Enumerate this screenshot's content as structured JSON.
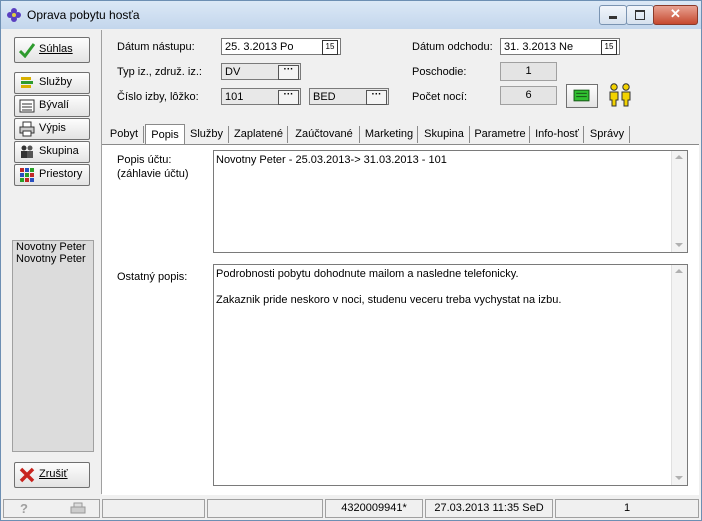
{
  "window": {
    "title": "Oprava pobytu hosťa"
  },
  "sidebar": {
    "buttons": [
      {
        "label": "Súhlas"
      },
      {
        "label": "Služby"
      },
      {
        "label": "Bývalí"
      },
      {
        "label": "Výpis"
      },
      {
        "label": "Skupina"
      },
      {
        "label": "Priestory"
      }
    ],
    "guests": [
      "Novotny Peter",
      "Novotny Peter"
    ],
    "cancel_label": "Zrušiť"
  },
  "form": {
    "arrival_label": "Dátum nástupu:",
    "arrival_value": "25. 3.2013  Po",
    "departure_label": "Dátum odchodu:",
    "departure_value": "31. 3.2013  Ne",
    "type_label": "Typ iz., združ. iz.:",
    "type_value": "DV",
    "floor_label": "Poschodie:",
    "floor_value": "1",
    "room_label": "Číslo izby, lôžko:",
    "room_value": "101",
    "bed_value": "BED",
    "nights_label": "Počet nocí:",
    "nights_value": "6",
    "calendar_icon_text": "15"
  },
  "tabs": [
    {
      "label": "Pobyt"
    },
    {
      "label": "Popis"
    },
    {
      "label": "Služby"
    },
    {
      "label": "Zaplatené"
    },
    {
      "label": "Zaúčtované"
    },
    {
      "label": "Marketing"
    },
    {
      "label": "Skupina"
    },
    {
      "label": "Parametre"
    },
    {
      "label": "Info-hosť"
    },
    {
      "label": "Správy"
    }
  ],
  "popis": {
    "account_label_1": "Popis účtu:",
    "account_label_2": "(záhlavie účtu)",
    "account_text": "Novotny Peter - 25.03.2013-> 31.03.2013 - 101",
    "other_label": "Ostatný popis:",
    "other_line_1": "Podrobnosti pobytu dohodnute mailom a nasledne telefonicky.",
    "other_line_2": "Zakaznik pride neskoro v noci, studenu veceru treba vychystat na izbu."
  },
  "status": {
    "code": "4320009941*",
    "datetime": "27.03.2013 11:35 SeD",
    "page": "1"
  },
  "colors": {
    "accent_green": "#2e9b2e",
    "cancel_red": "#c8241e",
    "person_yellow": "#f2d200"
  }
}
